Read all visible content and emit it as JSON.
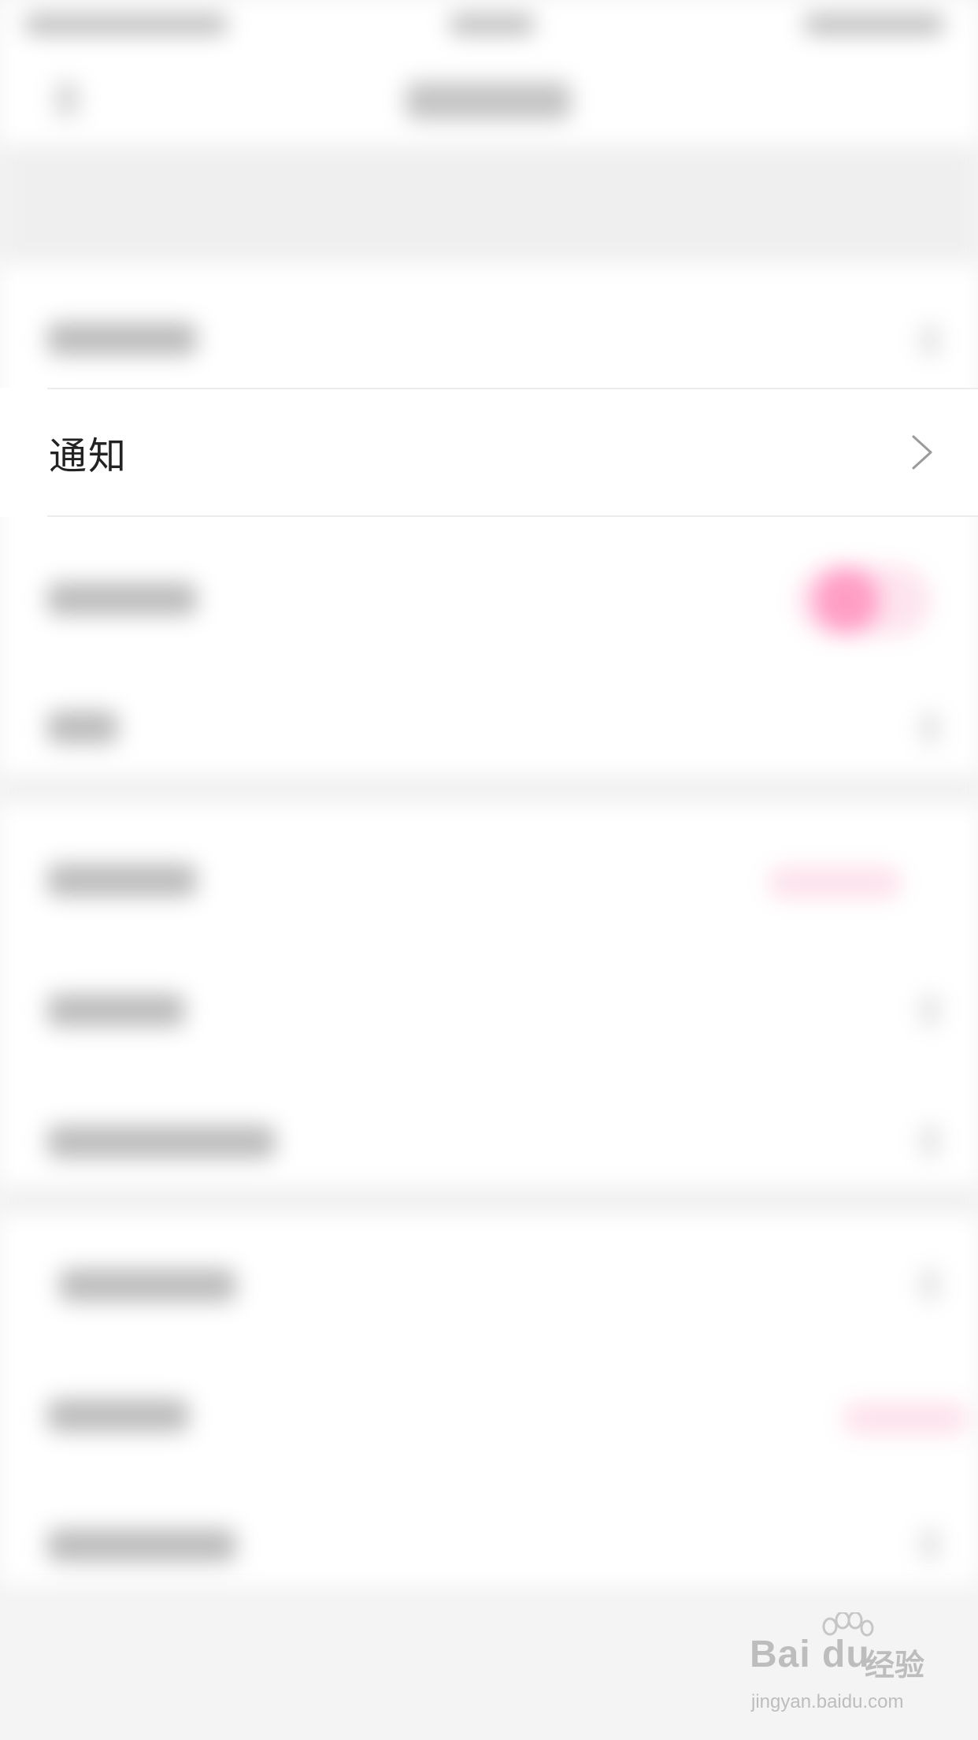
{
  "settings": {
    "rows": [
      {
        "label": "通知"
      }
    ]
  },
  "watermark": {
    "brand": "Bai  du",
    "suffix": "经验",
    "url": "jingyan.baidu.com"
  },
  "colors": {
    "toggle_accent": "#ff9ec5",
    "background": "#f4f4f4",
    "row_background": "#ffffff"
  }
}
